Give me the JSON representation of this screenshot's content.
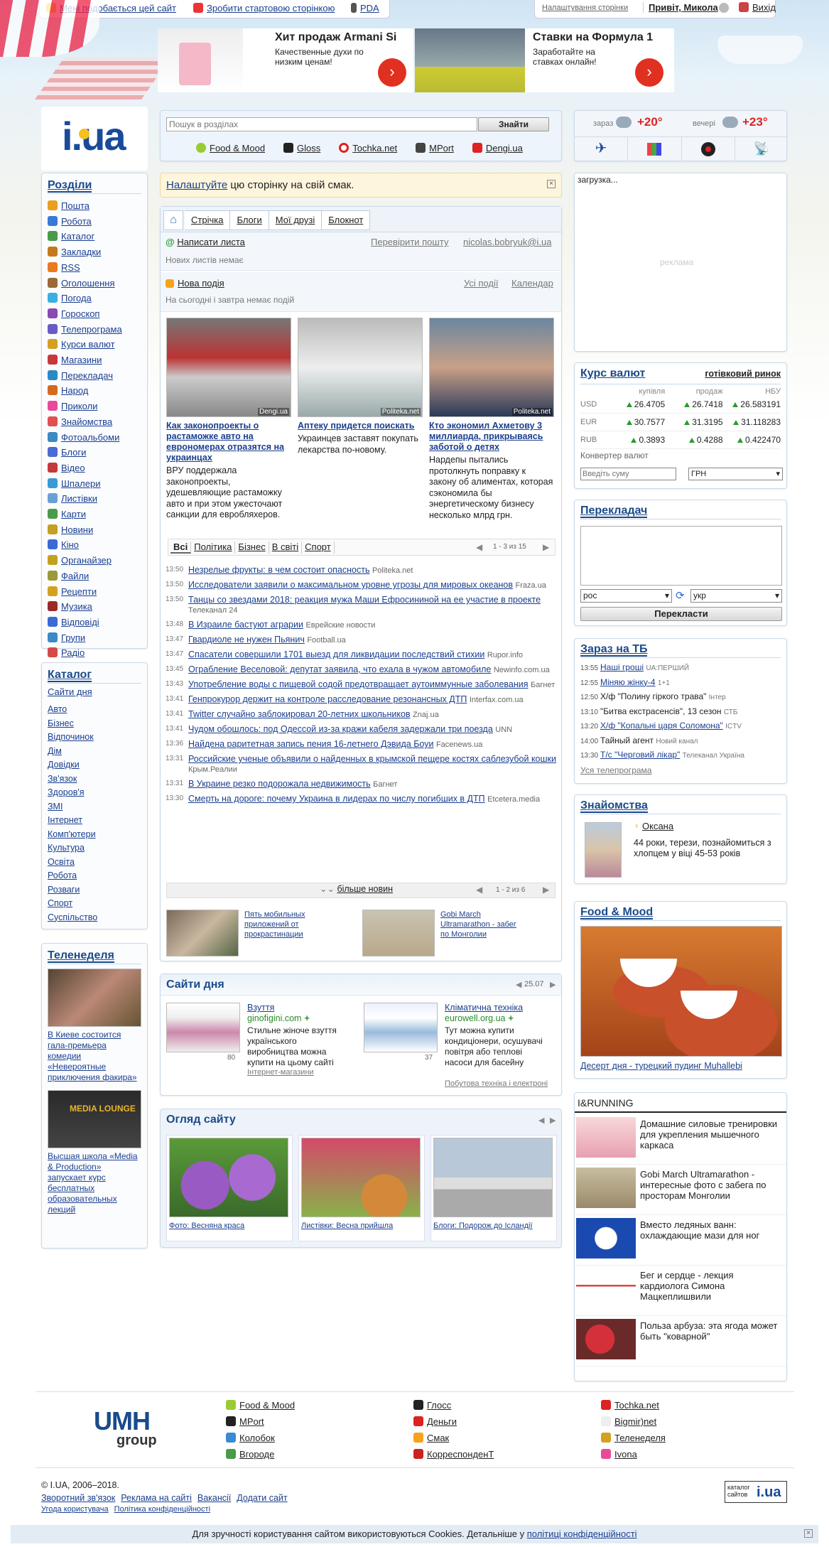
{
  "topbar": {
    "like": "Мені подобається цей сайт",
    "home": "Зробити стартовою сторінкою",
    "pda": "PDA",
    "settings": "Налаштування сторінки",
    "greeting": "Привіт, Микола",
    "logout": "Вихід"
  },
  "ads": [
    {
      "title": "Хит продаж Armani Si",
      "text": "Качественные духи по низким ценам!"
    },
    {
      "title": "Ставки на Формула 1",
      "text": "Заработайте на ставках онлайн!"
    }
  ],
  "logo": "i.ua",
  "search": {
    "placeholder": "Пошук в розділах",
    "button": "Знайти",
    "links": [
      "Food & Mood",
      "Gloss",
      "Tochka.net",
      "MPort",
      "Dengi.ua"
    ]
  },
  "weather": {
    "now_label": "зараз",
    "now_temp": "+20°",
    "eve_label": "вечері",
    "eve_temp": "+23°"
  },
  "sections": {
    "title": "Розділи",
    "items": [
      "Пошта",
      "Робота",
      "Каталог",
      "Закладки",
      "RSS",
      "Оголошення",
      "Погода",
      "Гороскоп",
      "Телепрограма",
      "Курси валют",
      "Магазини",
      "Перекладач",
      "Народ",
      "Приколи",
      "Знайомства",
      "Фотоальбоми",
      "Блоги",
      "Відео",
      "Шпалери",
      "Листівки",
      "Карти",
      "Новини",
      "Кіно",
      "Органайзер",
      "Файли",
      "Рецепти",
      "Музика",
      "Відповіді",
      "Групи",
      "Радіо"
    ]
  },
  "catalog": {
    "title": "Каталог",
    "top": "Сайти дня",
    "items": [
      "Авто",
      "Бізнес",
      "Відпочинок",
      "Дім",
      "Довідки",
      "Зв'язок",
      "Здоров'я",
      "ЗМІ",
      "Інтернет",
      "Комп'ютери",
      "Культура",
      "Освіта",
      "Робота",
      "Розваги",
      "Спорт",
      "Суспільство"
    ]
  },
  "teleweek": {
    "title": "Теленеделя",
    "item1": "В Киеве состоится гала-премьера комедии «Невероятные приключения факира»",
    "item2": "Высшая школа «Media & Production» запускает курс бесплатных образовательных лекций"
  },
  "notice": {
    "link": "Налаштуйте",
    "text": " цю сторінку на свій смак."
  },
  "tabs": [
    "Стрічка",
    "Блоги",
    "Мої друзі",
    "Блокнот"
  ],
  "mail": {
    "write": "Написати листа",
    "check": "Перевірити пошту",
    "email": "nicolas.bobryuk@i.ua",
    "empty": "Нових листів немає"
  },
  "events": {
    "new": "Нова подія",
    "all": "Усі події",
    "calendar": "Календар",
    "empty": "На сьогодні і завтра немає подій"
  },
  "top_news": [
    {
      "src": "Dengi.ua",
      "title": "Как законопроекты о растаможке авто на еврономерах отразятся на украинцах",
      "text": "ВРУ поддержала законопроекты, удешевляющие растаможку авто и при этом ужесточают санкции для евробляхеров."
    },
    {
      "src": "Politeka.net",
      "title": "Аптеку придется поискать",
      "text": "Украинцев заставят покупать лекарства по-новому."
    },
    {
      "src": "Politeka.net",
      "title": "Кто экономил Ахметову 3 миллиарда, прикрываясь заботой о детях",
      "text": "Нардепы пытались протолкнуть поправку к закону об алиментах, которая сэкономила бы энергетическому бизнесу несколько млрд грн."
    }
  ],
  "news_tabs": [
    "Всі",
    "Політика",
    "Бізнес",
    "В світі",
    "Спорт"
  ],
  "news_pager": "1 - 3 из 15",
  "news": [
    {
      "t": "13:50",
      "h": "Незрелые фрукты: в чем состоит опасность",
      "s": "Politeka.net"
    },
    {
      "t": "13:50",
      "h": "Исследователи заявили о максимальном уровне угрозы для мировых океанов",
      "s": "Fraza.ua"
    },
    {
      "t": "13:50",
      "h": "Танцы со звездами 2018: реакция мужа Маши Ефросининой на ее участие в проекте",
      "s": "Телеканал 24"
    },
    {
      "t": "13:48",
      "h": "В Израиле бастуют аграрии",
      "s": "Еврейские новости"
    },
    {
      "t": "13:47",
      "h": "Гвардиоле не нужен Пьянич",
      "s": "Football.ua"
    },
    {
      "t": "13:47",
      "h": "Спасатели совершили 1701 выезд для ликвидации последствий стихии",
      "s": "Rupor.info"
    },
    {
      "t": "13:45",
      "h": "Ограбление Веселовой: депутат заявила, что ехала в чужом автомобиле",
      "s": "Newinfo.com.ua"
    },
    {
      "t": "13:43",
      "h": "Употребление воды с пищевой содой предотвращает аутоиммунные заболевания",
      "s": "Багнет"
    },
    {
      "t": "13:41",
      "h": "Генпрокурор держит на контроле расследование резонансных ДТП",
      "s": "Interfax.com.ua"
    },
    {
      "t": "13:41",
      "h": "Twitter случайно заблокировал 20-летних школьников",
      "s": "Znaj.ua"
    },
    {
      "t": "13:41",
      "h": "Чудом обошлось: под Одессой из-за кражи кабеля задержали три поезда",
      "s": "UNN"
    },
    {
      "t": "13:36",
      "h": "Найдена раритетная запись пения 16-летнего Дэвида Боуи",
      "s": "Facenews.ua"
    },
    {
      "t": "13:31",
      "h": "Российские ученые объявили о найденных в крымской пещере костях саблезубой кошки",
      "s": "Крым.Реалии"
    },
    {
      "t": "13:31",
      "h": "В Украине резко подорожала недвижимость",
      "s": "Багнет"
    },
    {
      "t": "13:30",
      "h": "Смерть на дороге: почему Украина в лидерах по числу погибших в ДТП",
      "s": "Etcetera.media"
    }
  ],
  "more_news": "більше новин",
  "bottom_pager": "1 - 2 из 6",
  "bottom_news": [
    "Пять мобильных приложений от прокрастинации",
    "Gobi March Ultramarathon - забег по Монголии"
  ],
  "sites_day": {
    "title": "Сайти дня",
    "date": "25.07",
    "items": [
      {
        "cat": "Взуття",
        "site": "ginofigini.com",
        "count": "80",
        "text": "Стильне жіноче взуття українського виробництва можна купити на цьому сайті",
        "section": "Інтернет-магазини"
      },
      {
        "cat": "Кліматична техніка",
        "site": "eurowell.org.ua",
        "count": "37",
        "text": "Тут можна купити кондиціонери, осушувачі повітря або теплові насоси для басейну",
        "section": "Побутова техніка і електроні"
      }
    ]
  },
  "review": {
    "title": "Огляд сайту",
    "items": [
      "Фото: Весняна краса",
      "Листівки: Весна прийшла",
      "Блоги: Подорож до Ісландії"
    ]
  },
  "ad_right": {
    "loading": "загрузка...",
    "label": "реклама"
  },
  "currency": {
    "title": "Курс валют",
    "mode": "готівковий ринок",
    "cols": [
      "купівля",
      "продаж",
      "НБУ"
    ],
    "rows": [
      {
        "c": "USD",
        "b": "26.4705",
        "s": "26.7418",
        "n": "26.583191"
      },
      {
        "c": "EUR",
        "b": "30.7577",
        "s": "31.3195",
        "n": "31.118283"
      },
      {
        "c": "RUB",
        "b": "0.3893",
        "s": "0.4288",
        "n": "0.422470"
      }
    ],
    "converter": "Конвертер валют",
    "input_placeholder": "Введіть суму",
    "currency_sel": "ГРН"
  },
  "translator": {
    "title": "Перекладач",
    "from": "рос",
    "to": "укр",
    "button": "Перекласти"
  },
  "tv": {
    "title": "Зараз на ТБ",
    "items": [
      {
        "t": "13:55",
        "p": "Наші гроші",
        "c": "UA:ПЕРШИЙ",
        "link": true
      },
      {
        "t": "12:55",
        "p": "Міняю жінку-4",
        "c": "1+1",
        "link": true
      },
      {
        "t": "12:50",
        "p": "Х/ф \"Полину гіркого трава\"",
        "c": "Інтер",
        "link": false
      },
      {
        "t": "13:10",
        "p": "\"Битва екстрасенсів\", 13 сезон",
        "c": "СТБ",
        "link": false
      },
      {
        "t": "13:20",
        "p": "Х/ф \"Копальні царя Соломона\"",
        "c": "ICTV",
        "link": true
      },
      {
        "t": "14:00",
        "p": "Тайный агент",
        "c": "Новий канал",
        "link": false
      },
      {
        "t": "13:30",
        "p": "Т/с \"Черговий лікар\"",
        "c": "Телеканал Україна",
        "link": true
      }
    ],
    "all": "Уся телепрограма"
  },
  "dating": {
    "title": "Знайомства",
    "name": "Оксана",
    "text": "44 роки, терези, познайомиться з хлопцем у віці 45-53 років"
  },
  "food": {
    "title": "Food & Mood",
    "caption": "Десерт дня - турецкий пудинг Muhallebi"
  },
  "running": {
    "title": "I&RUNNING",
    "items": [
      "Домашние силовые тренировки для укрепления мышечного каркаса",
      "Gobi March Ultramarathon - интересные фото с забега по просторам Монголии",
      "Вместо ледяных ванн: охлаждающие мази для ног",
      "Бег и сердце - лекция кардиолога Симона Мацкеплишвили",
      "Польза арбуза: эта ягода может быть \"коварной\""
    ]
  },
  "footer": {
    "logo_top": "UMH",
    "logo_bottom": "group",
    "col1": [
      "Food & Mood",
      "MPort",
      "Колобок",
      "Вгороде"
    ],
    "col2": [
      "Глосс",
      "Деньги",
      "Смак",
      "КорреспонденТ"
    ],
    "col3": [
      "Tochka.net",
      "Bigmir)net",
      "Теленеделя",
      "Ivona"
    ],
    "copyright": "© I.UA, 2006–2018.",
    "links": [
      "Зворотний зв'язок",
      "Реклама на сайті",
      "Вакансії",
      "Додати сайт"
    ],
    "links2": [
      "Угода користувача",
      "Політика конфіденційності"
    ],
    "badge_top": "каталог сайтов",
    "badge_logo": "i.ua"
  },
  "cookie": {
    "text": "Для зручності користування сайтом використовуються Cookies. Детальніше у ",
    "link": "політиці конфіденційності"
  },
  "colors": {
    "brand": "#1a4a8a",
    "link": "#1a3f8f",
    "accent_red": "#e03020",
    "up_green": "#2a9a2a"
  }
}
